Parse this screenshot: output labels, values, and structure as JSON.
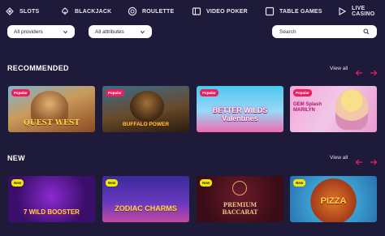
{
  "nav": [
    {
      "label": "SLOTS",
      "icon": "slot-machine-icon"
    },
    {
      "label": "BLACKJACK",
      "icon": "cards-icon"
    },
    {
      "label": "ROULETTE",
      "icon": "roulette-icon"
    },
    {
      "label": "VIDEO POKER",
      "icon": "video-poker-icon"
    },
    {
      "label": "TABLE GAMES",
      "icon": "table-games-icon"
    },
    {
      "label": "LIVE CASINO",
      "icon": "live-casino-icon"
    }
  ],
  "filters": {
    "providers": "All providers",
    "attributes": "All attributes",
    "search_placeholder": "Search"
  },
  "sections": [
    {
      "title": "RECOMMENDED",
      "view_all": "View all",
      "games": [
        {
          "name": "QUEST WEST",
          "badge": "Popular"
        },
        {
          "name": "BUFFALO POWER",
          "badge": "Popular"
        },
        {
          "name": "BETTER WILDS Valentines",
          "badge": "Popular"
        },
        {
          "name": "GEM Splash MARILYN",
          "badge": "Popular"
        }
      ]
    },
    {
      "title": "NEW",
      "view_all": "View all",
      "games": [
        {
          "name": "7 WILD BOOSTER",
          "badge": "New"
        },
        {
          "name": "ZODIAC CHARMS",
          "badge": "New"
        },
        {
          "name": "PREMIUM BACCARAT",
          "badge": "New"
        },
        {
          "name": "PIZZA",
          "badge": "New"
        }
      ]
    }
  ],
  "colors": {
    "background": "#1e1a3a",
    "accent": "#e8215e",
    "new_badge": "#f1e900"
  }
}
